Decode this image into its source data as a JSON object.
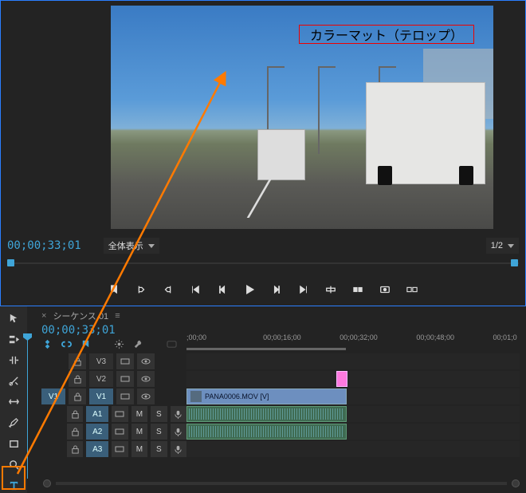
{
  "monitor": {
    "timecode": "00;00;33;01",
    "zoom_fit_label": "全体表示",
    "zoom_fraction_label": "1/2"
  },
  "telop": {
    "label": "カラーマット（テロップ）"
  },
  "playback": {
    "buttons": [
      "marker-icon",
      "in-point-icon",
      "out-point-icon",
      "go-to-in-icon",
      "step-back-icon",
      "play-icon",
      "step-forward-icon",
      "go-to-out-icon",
      "insert-icon",
      "overwrite-icon",
      "export-frame-icon",
      "comparison-view-icon"
    ]
  },
  "timeline": {
    "sequence_tab": "シーケンス 01",
    "timecode": "00;00;33;01",
    "ruler_ticks": [
      {
        "label": ";00;00",
        "pct": 0
      },
      {
        "label": "00;00;16;00",
        "pct": 23
      },
      {
        "label": "00;00;32;00",
        "pct": 46
      },
      {
        "label": "00;00;48;00",
        "pct": 69
      },
      {
        "label": "00;01;0",
        "pct": 92
      }
    ],
    "playhead_pct": 47.5,
    "video_tracks": [
      {
        "id": "V3",
        "source": false,
        "clips": []
      },
      {
        "id": "V2",
        "source": false,
        "clips": [
          {
            "type": "pink_matte",
            "left_pct": 45,
            "width_pct": 4
          }
        ]
      },
      {
        "id": "V1",
        "source": true,
        "clips": [
          {
            "type": "video",
            "label": "PANA0006.MOV [V]",
            "left_pct": 0,
            "width_pct": 48
          }
        ]
      }
    ],
    "audio_tracks": [
      {
        "id": "A1",
        "source": true,
        "clips": [
          {
            "type": "audio",
            "left_pct": 0,
            "width_pct": 48
          }
        ]
      },
      {
        "id": "A2",
        "source": false,
        "clips": [
          {
            "type": "audio",
            "left_pct": 0,
            "width_pct": 48
          }
        ]
      },
      {
        "id": "A3",
        "source": false,
        "clips": []
      }
    ],
    "track_header_buttons": {
      "mute": "M",
      "solo": "S"
    }
  },
  "tools": [
    "selection-tool",
    "track-select-tool",
    "ripple-edit-tool",
    "razor-tool",
    "slip-tool",
    "pen-tool",
    "rectangle-tool",
    "zoom-tool",
    "type-tool"
  ]
}
